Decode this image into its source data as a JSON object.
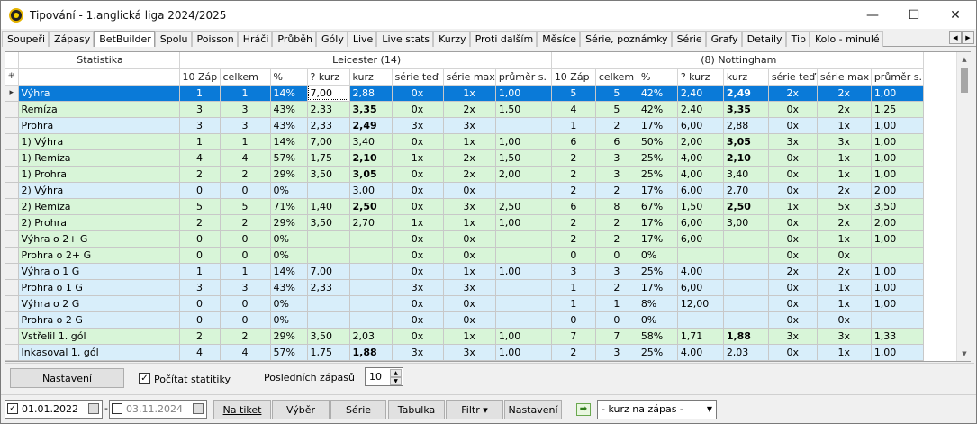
{
  "window": {
    "title": "Tipování - 1.anglická liga 2024/2025",
    "min": "—",
    "max": "☐",
    "close": "✕"
  },
  "tabs": [
    "Soupeři",
    "Zápasy",
    "BetBuilder",
    "Spolu",
    "Poisson",
    "Hráči",
    "Průběh",
    "Góly",
    "Live",
    "Live stats",
    "Kurzy",
    "Proti dalším",
    "Měsíce",
    "Série, poznámky",
    "Série",
    "Grafy",
    "Detaily",
    "Tip",
    "Kolo - minulé"
  ],
  "active_tab": "BetBuilder",
  "grid": {
    "header_top": {
      "stat": "Statistika",
      "home": "Leicester (14)",
      "away": "(8) Nottingham"
    },
    "corner": "⁜",
    "columns": [
      "10 Záp",
      "celkem",
      "%",
      "? kurz",
      "kurz",
      "série teď",
      "série max",
      "průměr s."
    ],
    "rows": [
      {
        "label": "Výhra",
        "c": "sel",
        "h": [
          "1",
          "1",
          "14%",
          "7,00",
          "2,88",
          "0x",
          "1x",
          "1,00"
        ],
        "a": [
          "5",
          "5",
          "42%",
          "2,40",
          "2,49",
          "2x",
          "2x",
          "1,00"
        ]
      },
      {
        "label": "Remíza",
        "c": "g",
        "h": [
          "3",
          "3",
          "43%",
          "2,33",
          "3,35",
          "0x",
          "2x",
          "1,50"
        ],
        "a": [
          "4",
          "5",
          "42%",
          "2,40",
          "3,35",
          "0x",
          "2x",
          "1,25"
        ]
      },
      {
        "label": "Prohra",
        "c": "bl",
        "h": [
          "3",
          "3",
          "43%",
          "2,33",
          "2,49",
          "3x",
          "3x",
          ""
        ],
        "a": [
          "1",
          "2",
          "17%",
          "6,00",
          "2,88",
          "0x",
          "1x",
          "1,00"
        ]
      },
      {
        "label": "1) Výhra",
        "c": "g",
        "h": [
          "1",
          "1",
          "14%",
          "7,00",
          "3,40",
          "0x",
          "1x",
          "1,00"
        ],
        "a": [
          "6",
          "6",
          "50%",
          "2,00",
          "3,05",
          "3x",
          "3x",
          "1,00"
        ]
      },
      {
        "label": "1) Remíza",
        "c": "g",
        "h": [
          "4",
          "4",
          "57%",
          "1,75",
          "2,10",
          "1x",
          "2x",
          "1,50"
        ],
        "a": [
          "2",
          "3",
          "25%",
          "4,00",
          "2,10",
          "0x",
          "1x",
          "1,00"
        ]
      },
      {
        "label": "1) Prohra",
        "c": "g",
        "h": [
          "2",
          "2",
          "29%",
          "3,50",
          "3,05",
          "0x",
          "2x",
          "2,00"
        ],
        "a": [
          "2",
          "3",
          "25%",
          "4,00",
          "3,40",
          "0x",
          "1x",
          "1,00"
        ]
      },
      {
        "label": "2) Výhra",
        "c": "bl",
        "h": [
          "0",
          "0",
          "0%",
          "",
          "3,00",
          "0x",
          "0x",
          ""
        ],
        "a": [
          "2",
          "2",
          "17%",
          "6,00",
          "2,70",
          "0x",
          "2x",
          "2,00"
        ]
      },
      {
        "label": "2) Remíza",
        "c": "g",
        "h": [
          "5",
          "5",
          "71%",
          "1,40",
          "2,50",
          "0x",
          "3x",
          "2,50"
        ],
        "a": [
          "6",
          "8",
          "67%",
          "1,50",
          "2,50",
          "1x",
          "5x",
          "3,50"
        ]
      },
      {
        "label": "2) Prohra",
        "c": "g",
        "h": [
          "2",
          "2",
          "29%",
          "3,50",
          "2,70",
          "1x",
          "1x",
          "1,00"
        ],
        "a": [
          "2",
          "2",
          "17%",
          "6,00",
          "3,00",
          "0x",
          "2x",
          "2,00"
        ]
      },
      {
        "label": "Výhra o 2+ G",
        "c": "g",
        "h": [
          "0",
          "0",
          "0%",
          "",
          "",
          "0x",
          "0x",
          ""
        ],
        "a": [
          "2",
          "2",
          "17%",
          "6,00",
          "",
          "0x",
          "1x",
          "1,00"
        ]
      },
      {
        "label": "Prohra o 2+ G",
        "c": "g",
        "h": [
          "0",
          "0",
          "0%",
          "",
          "",
          "0x",
          "0x",
          ""
        ],
        "a": [
          "0",
          "0",
          "0%",
          "",
          "",
          "0x",
          "0x",
          ""
        ]
      },
      {
        "label": "Výhra o 1 G",
        "c": "bl",
        "h": [
          "1",
          "1",
          "14%",
          "7,00",
          "",
          "0x",
          "1x",
          "1,00"
        ],
        "a": [
          "3",
          "3",
          "25%",
          "4,00",
          "",
          "2x",
          "2x",
          "1,00"
        ]
      },
      {
        "label": "Prohra o 1 G",
        "c": "bl",
        "h": [
          "3",
          "3",
          "43%",
          "2,33",
          "",
          "3x",
          "3x",
          ""
        ],
        "a": [
          "1",
          "2",
          "17%",
          "6,00",
          "",
          "0x",
          "1x",
          "1,00"
        ]
      },
      {
        "label": "Výhra o 2 G",
        "c": "bl",
        "h": [
          "0",
          "0",
          "0%",
          "",
          "",
          "0x",
          "0x",
          ""
        ],
        "a": [
          "1",
          "1",
          "8%",
          "12,00",
          "",
          "0x",
          "1x",
          "1,00"
        ]
      },
      {
        "label": "Prohra o 2 G",
        "c": "bl",
        "h": [
          "0",
          "0",
          "0%",
          "",
          "",
          "0x",
          "0x",
          ""
        ],
        "a": [
          "0",
          "0",
          "0%",
          "",
          "",
          "0x",
          "0x",
          ""
        ]
      },
      {
        "label": "Vstřelil 1. gól",
        "c": "g",
        "h": [
          "2",
          "2",
          "29%",
          "3,50",
          "2,03",
          "0x",
          "1x",
          "1,00"
        ],
        "a": [
          "7",
          "7",
          "58%",
          "1,71",
          "1,88",
          "3x",
          "3x",
          "1,33"
        ]
      },
      {
        "label": "Inkasoval 1. gól",
        "c": "bl",
        "h": [
          "4",
          "4",
          "57%",
          "1,75",
          "1,88",
          "3x",
          "3x",
          "1,00"
        ],
        "a": [
          "2",
          "3",
          "25%",
          "4,00",
          "2,03",
          "0x",
          "1x",
          "1,00"
        ]
      }
    ]
  },
  "options": {
    "settings_button": "Nastavení",
    "count_stats_label": "Počítat statitiky",
    "count_stats_checked": "✓",
    "last_matches_label": "Posledních zápasů",
    "last_matches_value": "10"
  },
  "bottom": {
    "date_from": "01.01.2022",
    "date_from_checked": "✓",
    "sep": "-",
    "date_to": "03.11.2024",
    "buttons": [
      "Na tiket",
      "Výběr",
      "Série",
      "Tabulka",
      "Filtr ▾",
      "Nastavení"
    ],
    "combo_value": "- kurz na zápas -"
  }
}
